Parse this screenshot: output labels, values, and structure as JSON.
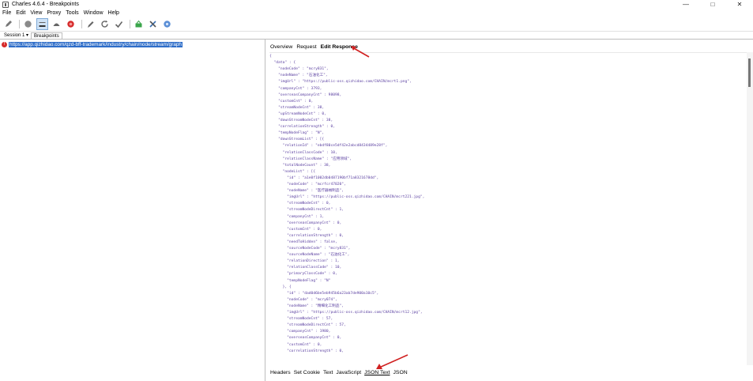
{
  "window": {
    "title": "Charles 4.6.4 - Breakpoints",
    "controls": {
      "minimize": "—",
      "maximize": "□",
      "close": "✕"
    }
  },
  "menu": [
    "File",
    "Edit",
    "View",
    "Proxy",
    "Tools",
    "Window",
    "Help"
  ],
  "toolbar": {
    "icons": [
      "pen-icon",
      "record-icon",
      "throttle-icon",
      "turtle-icon",
      "breakpoint-icon",
      "compose-icon",
      "refresh-icon",
      "check-icon",
      "basket-icon",
      "tools-icon",
      "settings-icon"
    ],
    "colors": {
      "record": "#8a8a8a",
      "breakpoint": "#d62b2b",
      "basket": "#3aa54a",
      "settings": "#5b8fd6",
      "active_bg": "#cfe3f7"
    }
  },
  "session": {
    "tabs": [
      "Session 1 ▾",
      "Breakpoints"
    ]
  },
  "left": {
    "url": "https://app.qizhidao.com/qzd-bff-trademark/industry/chain/node/stream/graph"
  },
  "right": {
    "top_tabs": [
      "Overview",
      "Request",
      "Edit Response"
    ],
    "bottom_tabs": [
      "Headers",
      "Set Cookie",
      "Text",
      "JavaScript",
      "JSON Text",
      "JSON"
    ],
    "code_lines": [
      "{",
      "  \"data\" : {",
      "    \"nodeCode\" : \"mcry831\",",
      "    \"nodeName\" : \"石油化工\",",
      "    \"imgUrl\" : \"https://public-oss.qizhidao.com/CHAIN/mcrt1.png\",",
      "    \"companyCnt\" : 3793,",
      "    \"overseasCompanyCnt\" : 98098,",
      "    \"customCnt\" : 0,",
      "    \"streamNodeCnt\" : 38,",
      "    \"upStreamNodeCnt\" : 0,",
      "    \"downStreamNodeCnt\" : 38,",
      "    \"correlationStrength\" : 0,",
      "    \"tempNodeFlag\" : \"N\",",
      "    \"downStreamList\" : [{",
      "      \"relationId\" : \"ebdf80ce5df42e2abcd8434489e28f\",",
      "      \"relationClassCode\" : 10,",
      "      \"relationClassName\" : \"应用领域\",",
      "      \"totalNodeCount\" : 38,",
      "      \"nodeList\" : [{",
      "        \"id\" : \"a1e0f1002db0487190bf71a8321678dd\",",
      "        \"nodeCode\" : \"mcrfcr47020\",",
      "        \"nodeName\" : \"医疗器械制品\",",
      "        \"imgUrl\" : \"https://public-oss.qizhidao.com/CHAIN/mcrt221.jpg\",",
      "        \"streamNodeCnt\" : 0,",
      "        \"streamNodeDirectCnt\" : 1,",
      "        \"companyCnt\" : 1,",
      "        \"overseasCompanyCnt\" : 0,",
      "        \"customCnt\" : 0,",
      "        \"correlationStrength\" : 0,",
      "        \"needToHidden\" : false,",
      "        \"sourceNodeCode\" : \"mcry831\",",
      "        \"sourceNodeName\" : \"石油化工\",",
      "        \"relationDirection\" : 1,",
      "        \"relationClassCode\" : 10,",
      "        \"primaryClassCode\" : 0,",
      "        \"tempNodeFlag\" : \"N\"",
      "      }, {",
      "        \"id\" : \"dad0d6be5eb945b6a23ab7de900a10c5\",",
      "        \"nodeCode\" : \"mcry074\",",
      "        \"nodeName\" : \"精细化工制品\",",
      "        \"imgUrl\" : \"https://public-oss.qizhidao.com/CHAIN/mcrt12.jpg\",",
      "        \"streamNodeCnt\" : 57,",
      "        \"streamNodeDirectCnt\" : 57,",
      "        \"companyCnt\" : 1980,",
      "        \"overseasCompanyCnt\" : 0,",
      "        \"customCnt\" : 0,",
      "        \"correlationStrength\" : 0,"
    ]
  },
  "annotations": {
    "arrow_color": "#d02020"
  }
}
